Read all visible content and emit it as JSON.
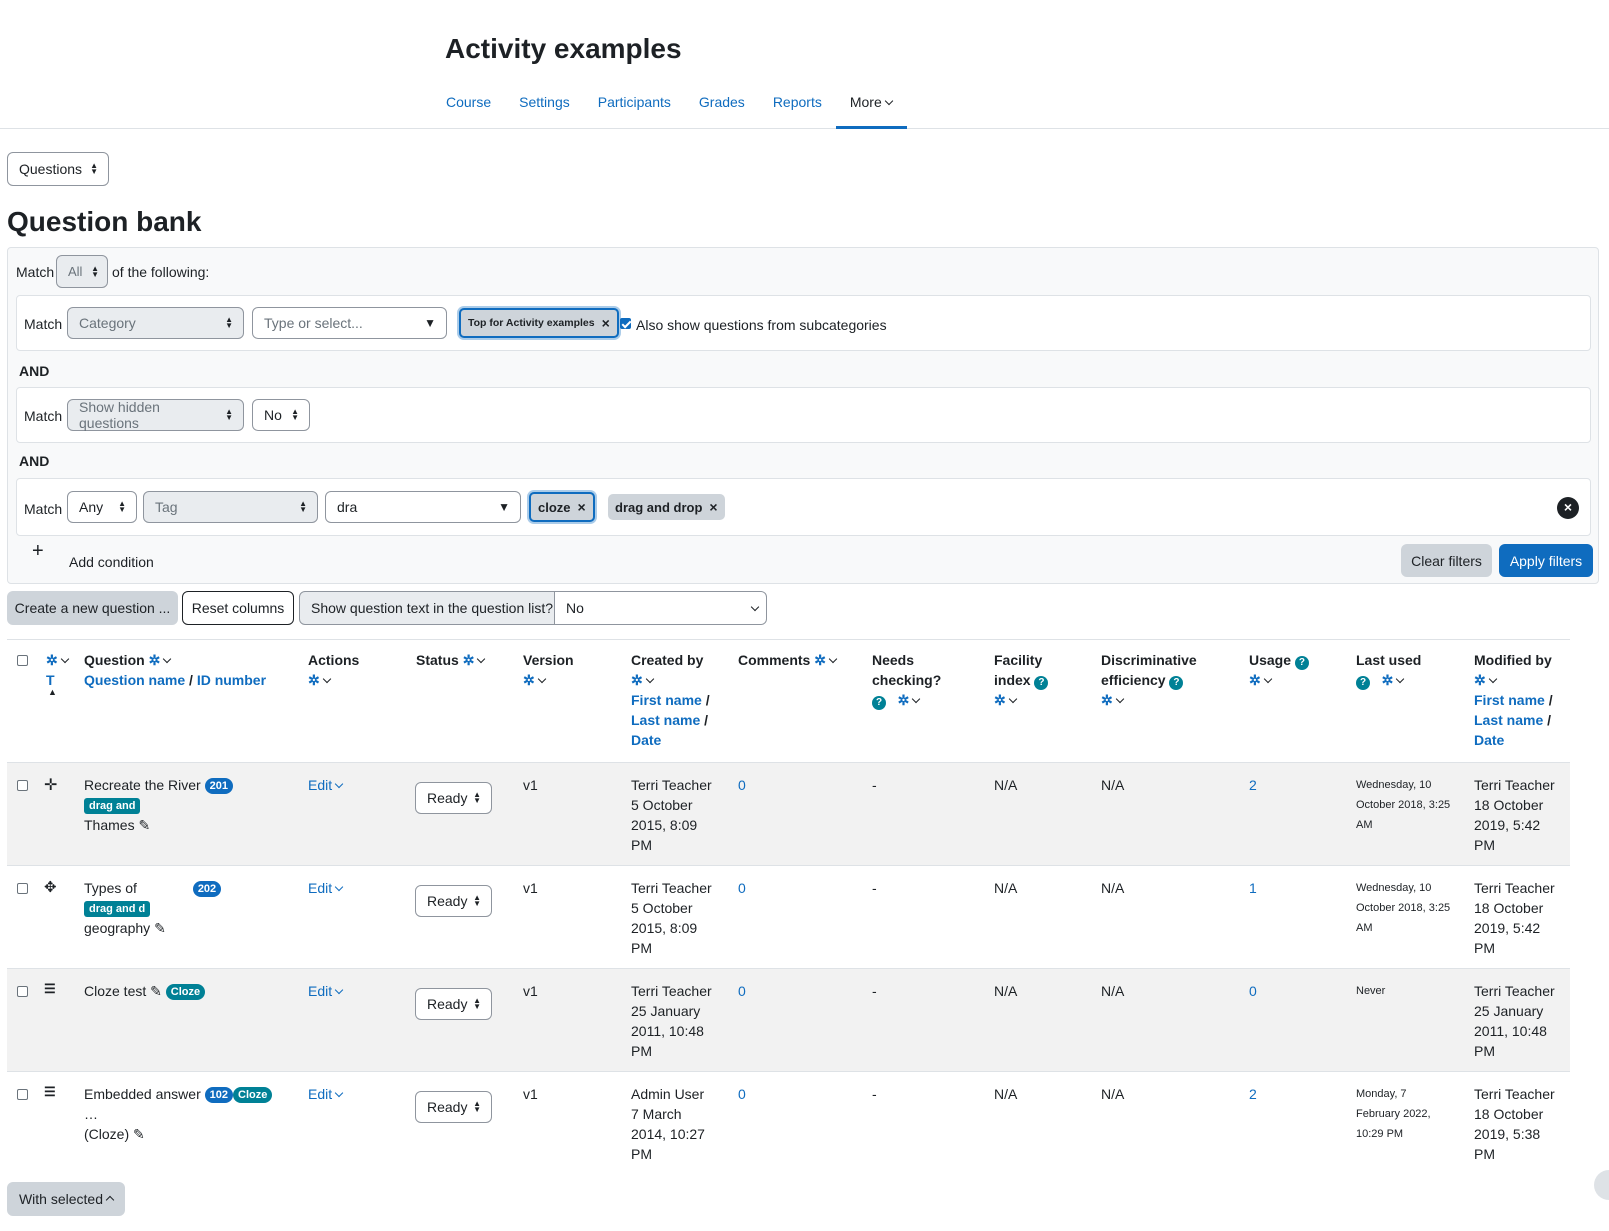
{
  "course_title": "Activity examples",
  "nav": [
    "Course",
    "Settings",
    "Participants",
    "Grades",
    "Reports",
    "More"
  ],
  "page_select": "Questions",
  "page_heading": "Question bank",
  "filters": {
    "match_label": "Match",
    "match_mode": "All",
    "of_following": "of the following:",
    "and_label": "AND",
    "cond1": {
      "field": "Category",
      "input_placeholder": "Type or select...",
      "chip": "Top for Activity examples",
      "subcat_label": "Also show questions from subcategories"
    },
    "cond2": {
      "field": "Show hidden questions",
      "value": "No"
    },
    "cond3": {
      "mode": "Any",
      "field": "Tag",
      "input_value": "dra",
      "chips": [
        "cloze",
        "drag and drop"
      ]
    },
    "add_condition": "Add condition",
    "clear": "Clear filters",
    "apply": "Apply filters"
  },
  "toolbar": {
    "create": "Create a new question ...",
    "reset": "Reset columns",
    "show_text_label": "Show question text in the question list?",
    "show_text_value": "No"
  },
  "columns": {
    "type_sort": "T",
    "question": "Question",
    "question_name": "Question name",
    "id_number": "ID number",
    "actions": "Actions",
    "status": "Status",
    "version": "Version",
    "created_by": "Created by",
    "first_name": "First name",
    "last_name": "Last name",
    "date": "Date",
    "comments": "Comments",
    "needs1": "Needs",
    "needs2": "checking?",
    "facility1": "Facility",
    "facility2": "index",
    "disc1": "Discriminative",
    "disc2": "efficiency",
    "usage": "Usage",
    "last_used": "Last used",
    "modified_by": "Modified by"
  },
  "rows": [
    {
      "name1": "Recreate the River",
      "name2": "Thames",
      "id": "201",
      "tag": "drag and",
      "edit": "Edit",
      "status": "Ready",
      "version": "v1",
      "c1": "Terri Teacher",
      "c2": "5 October",
      "c3": "2015, 8:09",
      "c4": "PM",
      "comments": "0",
      "needs": "-",
      "facility": "N/A",
      "disc": "N/A",
      "usage": "2",
      "lu1": "Wednesday, 10",
      "lu2": "October 2018, 3:25",
      "lu3": "AM",
      "m1": "Terri Teacher",
      "m2": "18 October",
      "m3": "2019, 5:42",
      "m4": "PM",
      "icon": "move-icon"
    },
    {
      "name1": "Types of",
      "name2": "geography",
      "id": "202",
      "tag": "drag and d",
      "edit": "Edit",
      "status": "Ready",
      "version": "v1",
      "c1": "Terri Teacher",
      "c2": "5 October",
      "c3": "2015, 8:09",
      "c4": "PM",
      "comments": "0",
      "needs": "-",
      "facility": "N/A",
      "disc": "N/A",
      "usage": "1",
      "lu1": "Wednesday, 10",
      "lu2": "October 2018, 3:25",
      "lu3": "AM",
      "m1": "Terri Teacher",
      "m2": "18 October",
      "m3": "2019, 5:42",
      "m4": "PM",
      "icon": "drag-markers-icon"
    },
    {
      "name1": "Cloze test",
      "name2": "",
      "id": "",
      "tag": "Cloze",
      "edit": "Edit",
      "status": "Ready",
      "version": "v1",
      "c1": "Terri Teacher",
      "c2": "25 January",
      "c3": "2011, 10:48",
      "c4": "PM",
      "comments": "0",
      "needs": "-",
      "facility": "N/A",
      "disc": "N/A",
      "usage": "0",
      "lu1": "Never",
      "lu2": "",
      "lu3": "",
      "m1": "Terri Teacher",
      "m2": "25 January",
      "m3": "2011, 10:48",
      "m4": "PM",
      "icon": "cloze-icon"
    },
    {
      "name1": "Embedded answer",
      "name2": "(Cloze)",
      "id": "102",
      "tag": "Cloze",
      "edit": "Edit",
      "status": "Ready",
      "version": "v1",
      "c1": "Admin User",
      "c2": "7 March",
      "c3": "2014, 10:27",
      "c4": "PM",
      "comments": "0",
      "needs": "-",
      "facility": "N/A",
      "disc": "N/A",
      "usage": "2",
      "lu1": "Monday, 7",
      "lu2": "February 2022,",
      "lu3": "10:29 PM",
      "m1": "Terri Teacher",
      "m2": "18 October",
      "m3": "2019, 5:38",
      "m4": "PM",
      "icon": "cloze-icon"
    }
  ],
  "with_selected": "With selected"
}
